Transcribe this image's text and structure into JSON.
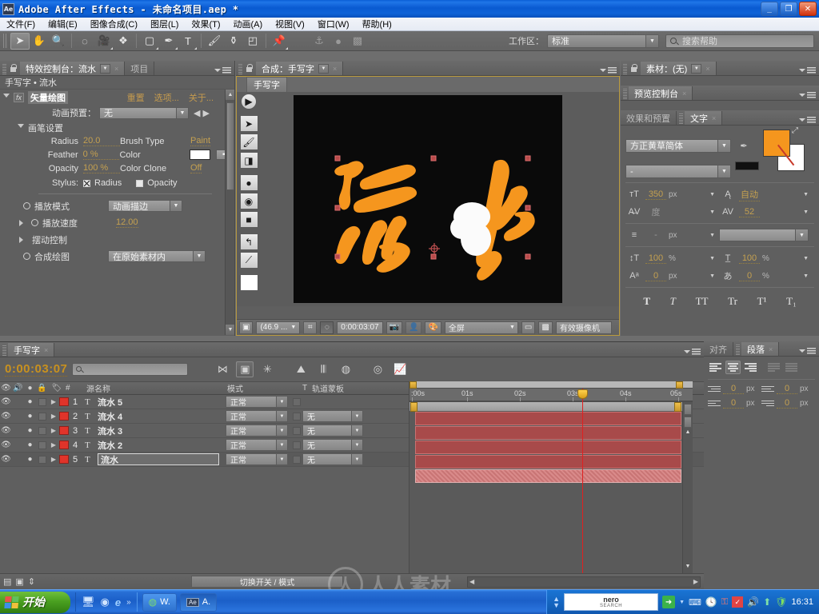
{
  "window": {
    "title": "Adobe After Effects - 未命名项目.aep *",
    "app_badge": "Ae",
    "minimize": "_",
    "maximize": "❐",
    "close": "✕"
  },
  "menubar": {
    "items": [
      "文件(F)",
      "编辑(E)",
      "图像合成(C)",
      "图层(L)",
      "效果(T)",
      "动画(A)",
      "视图(V)",
      "窗口(W)",
      "帮助(H)"
    ]
  },
  "toolbar": {
    "tools": [
      {
        "name": "selection-tool",
        "glyph": "➤",
        "selected": true
      },
      {
        "name": "hand-tool",
        "glyph": "✋",
        "selected": false
      },
      {
        "name": "zoom-tool",
        "glyph": "🔍",
        "selected": false
      },
      {
        "name": "rotation-tool",
        "glyph": "⟳",
        "selected": false
      },
      {
        "name": "camera-tool",
        "glyph": "🎥",
        "selected": false
      },
      {
        "name": "pan-behind-tool",
        "glyph": "✥",
        "selected": false
      },
      {
        "name": "shape-tool",
        "glyph": "▢",
        "selected": false
      },
      {
        "name": "pen-tool",
        "glyph": "✒",
        "selected": false
      },
      {
        "name": "type-tool",
        "glyph": "T",
        "selected": false
      },
      {
        "name": "brush-tool",
        "glyph": "🖌",
        "selected": false
      },
      {
        "name": "clone-stamp-tool",
        "glyph": "⛭",
        "selected": false
      },
      {
        "name": "eraser-tool",
        "glyph": "◪",
        "selected": false
      },
      {
        "name": "puppet-pin-tool",
        "glyph": "📌",
        "selected": false
      }
    ],
    "workspace_label": "工作区：",
    "workspace_value": "标准",
    "help_placeholder": "搜索帮助"
  },
  "effects_panel": {
    "tab_label": "特效控制台：流水",
    "tab2_label": "项目",
    "subtitle": "手写字 • 流水",
    "effect_name": "矢量绘图",
    "links": [
      "重置",
      "选项...",
      "关于..."
    ],
    "animation_preset_label": "动画预置：",
    "animation_preset_value": "无",
    "brush_group": "画笔设置",
    "props": [
      {
        "label": "Radius",
        "value": "20.0"
      },
      {
        "label": "Feather",
        "value": "0 %"
      },
      {
        "label": "Opacity",
        "value": "100 %"
      },
      {
        "label": "Brush Type",
        "value": "Paint"
      },
      {
        "label": "Color",
        "value": ""
      },
      {
        "label": "Color Clone",
        "value": "Off"
      }
    ],
    "stylus_label": "Stylus:",
    "stylus_radius": "Radius",
    "stylus_opacity": "Opacity",
    "playback_mode_label": "播放模式",
    "playback_mode_value": "动画描边",
    "playback_speed_label": "播放速度",
    "playback_speed_value": "12.00",
    "wiggle_label": "摆动控制",
    "composite_paint_label": "合成绘图",
    "composite_paint_value": "在原始素材内"
  },
  "comp_panel": {
    "tab_label": "合成：手写字",
    "subtab_label": "手写字",
    "canvas_text": "流水",
    "tools": [
      {
        "name": "play-paint-icon",
        "glyph": "▶"
      },
      {
        "name": "selection-tool-icon",
        "glyph": "➤"
      },
      {
        "name": "brush-tool-icon",
        "glyph": "🖌"
      },
      {
        "name": "eraser-tool-icon",
        "glyph": "◨"
      },
      {
        "name": "hard-brush-icon",
        "glyph": "●"
      },
      {
        "name": "soft-brush-icon",
        "glyph": "◉"
      },
      {
        "name": "square-brush-icon",
        "glyph": "■"
      },
      {
        "name": "undo-arrow-icon",
        "glyph": "↰"
      },
      {
        "name": "eyedropper-icon",
        "glyph": "⟋"
      },
      {
        "name": "color-swatch-icon",
        "glyph": ""
      }
    ],
    "footer": {
      "zoom": "(46.9 ...",
      "time": "0:00:03:07",
      "resolution": "全屏",
      "view": "有效摄像机",
      "icons": [
        "region-of-interest",
        "mask-toggle",
        "snapshot",
        "show-snapshot",
        "channels",
        "transparency-grid"
      ]
    }
  },
  "footage_panel": {
    "tab_label": "素材：(无)"
  },
  "preview_panel": {
    "tab_label": "预览控制台"
  },
  "character_panel": {
    "tab_effects": "效果和预置",
    "tab_text": "文字",
    "font_family": "方正黄草简体",
    "font_style": "-",
    "fill_color": "#F5961E",
    "stroke_color": "#FFFFFF",
    "font_size": "350",
    "font_size_unit": "px",
    "leading": "自动",
    "kerning": "度",
    "tracking": "52",
    "stroke_width": "-",
    "stroke_width_unit": "px",
    "stroke_type": "",
    "vertical_scale": "100",
    "vertical_scale_unit": "%",
    "horizontal_scale": "100",
    "horizontal_scale_unit": "%",
    "baseline_shift": "0",
    "baseline_shift_unit": "px",
    "tsume": "0",
    "tsume_unit": "%",
    "styles": [
      "T",
      "T",
      "TT",
      "Tr",
      "T¹",
      "T₁"
    ]
  },
  "paragraph_panel": {
    "tab_align": "对齐",
    "tab_paragraph": "段落",
    "align_buttons": [
      "align-left",
      "align-center",
      "align-right",
      "justify-last-left",
      "justify-all"
    ],
    "selected_align_index": 1,
    "fields": [
      {
        "name": "indent-left",
        "value": "0",
        "unit": "px"
      },
      {
        "name": "indent-right",
        "value": "0",
        "unit": "px"
      },
      {
        "name": "indent-first-line",
        "value": "0",
        "unit": "px"
      },
      {
        "name": "space-after",
        "value": "0",
        "unit": "px"
      }
    ]
  },
  "timeline": {
    "tab_label": "手写字",
    "current_time": "0:00:03:07",
    "search_placeholder": "",
    "columns": {
      "source_name": "源名称",
      "mode": "模式",
      "t": "T",
      "track_matte": "轨道蒙板",
      "number": "#"
    },
    "layers": [
      {
        "index": "1",
        "type": "T",
        "name": "流水 5",
        "mode": "正常",
        "matte": "",
        "selected": false
      },
      {
        "index": "2",
        "type": "T",
        "name": "流水 4",
        "mode": "正常",
        "matte": "无",
        "selected": false
      },
      {
        "index": "3",
        "type": "T",
        "name": "流水 3",
        "mode": "正常",
        "matte": "无",
        "selected": false
      },
      {
        "index": "4",
        "type": "T",
        "name": "流水 2",
        "mode": "正常",
        "matte": "无",
        "selected": false
      },
      {
        "index": "5",
        "type": "T",
        "name": "流水",
        "mode": "正常",
        "matte": "无",
        "selected": true
      }
    ],
    "ruler_labels": [
      ":00s",
      "01s",
      "02s",
      "03s",
      "04s",
      "05s"
    ],
    "toggle_switches_label": "切换开关 / 模式"
  },
  "taskbar": {
    "start_label": "开始",
    "quick_launch": [
      "show-desktop-icon",
      "media-player-icon",
      "internet-explorer-icon",
      "chevron-more-icon"
    ],
    "tasks": [
      {
        "name": "browser-task",
        "label": "W."
      },
      {
        "name": "after-effects-task",
        "label": "A.",
        "badge": "Ae",
        "active": true
      }
    ],
    "nero_title": "nero",
    "nero_sub": "SEARCH",
    "clock": "16:31"
  },
  "watermark": {
    "text": "人人素材"
  }
}
